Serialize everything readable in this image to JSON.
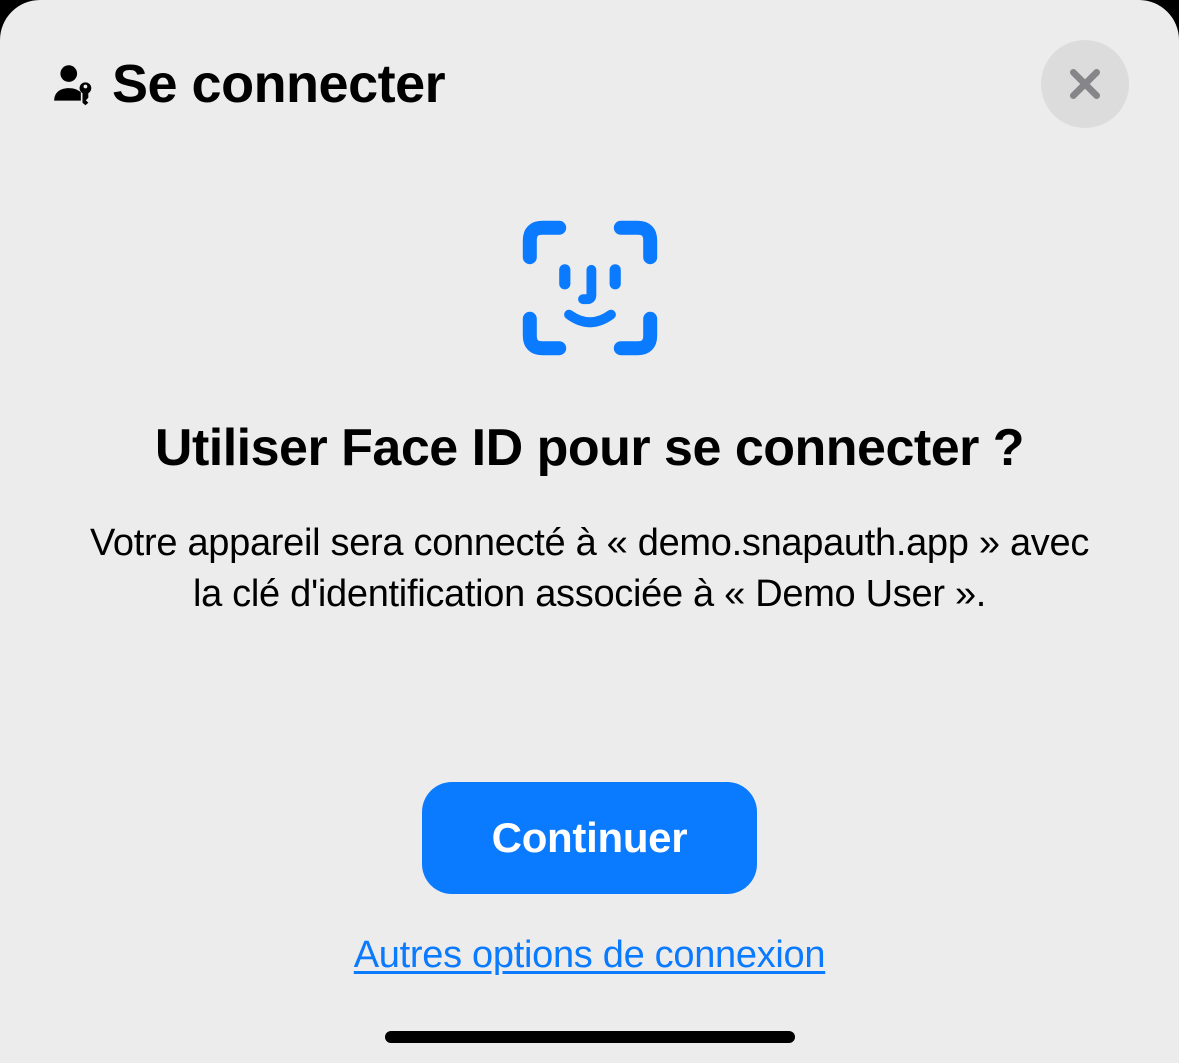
{
  "header": {
    "title": "Se connecter"
  },
  "prompt": {
    "title": "Utiliser Face ID pour se connecter ?",
    "description": "Votre appareil sera connecté à « demo.snapauth.app » avec la clé d'identification associée à « Demo User »."
  },
  "actions": {
    "continue_label": "Continuer",
    "other_options_label": "Autres options de connexion"
  },
  "colors": {
    "accent": "#0a7aff",
    "background": "#ececec",
    "close_bg": "#dcdcdc"
  }
}
